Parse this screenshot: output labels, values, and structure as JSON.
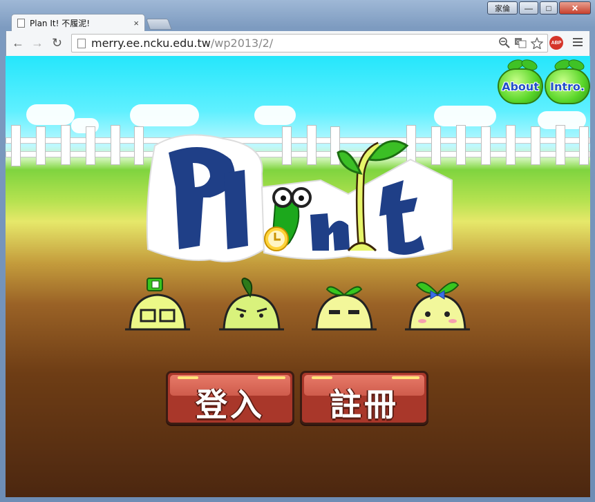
{
  "window": {
    "user_button": "家倫",
    "minimize": "—",
    "maximize": "□",
    "close": "✕"
  },
  "tab": {
    "title": "Plan It! 不履泥!",
    "close": "×"
  },
  "toolbar": {
    "back": "←",
    "forward": "→",
    "reload": "↻",
    "url_host": "merry.ee.ncku.edu.tw",
    "url_path": "/wp2013/2/",
    "adblock_label": "ABP"
  },
  "page": {
    "about_label": "About",
    "intro_label": "Intro.",
    "logo_text": "Plan It",
    "login_label": "登入",
    "register_label": "註冊"
  },
  "colors": {
    "sky": "#25e6fb",
    "grass": "#7fd43f",
    "soil": "#6e3d15",
    "button_red": "#a9372a",
    "logo_blue": "#1f3f87"
  }
}
